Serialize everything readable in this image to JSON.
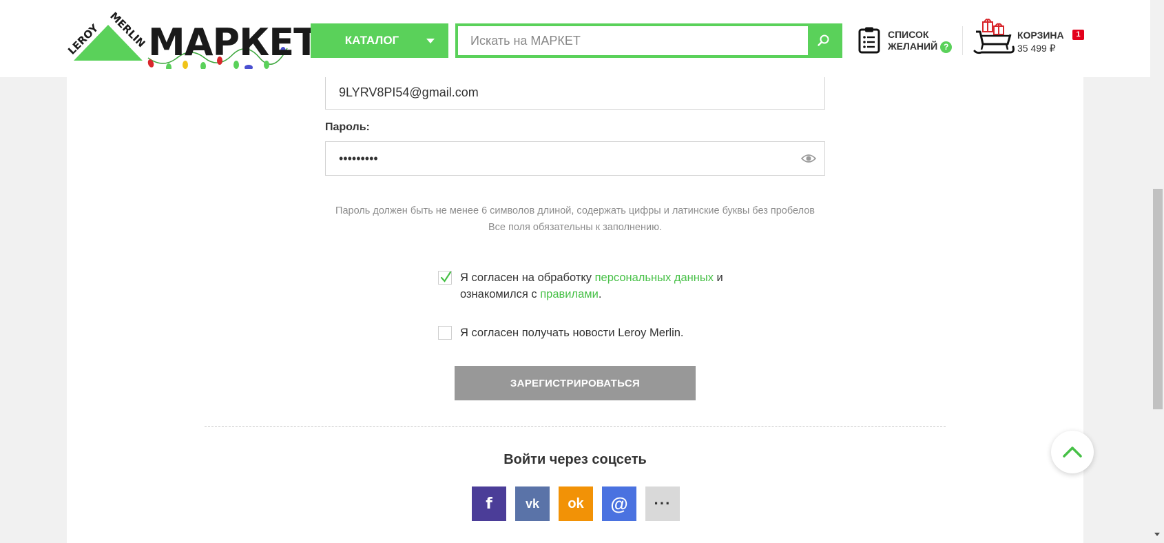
{
  "header": {
    "logo_brand": "LEROY MERLIN",
    "logo_word": "МАРКЕТ",
    "catalog_label": "КАТАЛОГ",
    "search_placeholder": "Искать на МАРКЕТ",
    "wishlist_line1": "СПИСОК",
    "wishlist_line2": "ЖЕЛАНИЙ",
    "wishlist_help": "?",
    "cart_title": "КОРЗИНА",
    "cart_total": "35 499 ₽",
    "cart_count": "1"
  },
  "form": {
    "email_value": "9LYRV8PI54@gmail.com",
    "password_label": "Пароль:",
    "password_value": "•••••••••",
    "hint_password": "Пароль должен быть не менее 6 символов длиной, содержать цифры и латинские буквы без пробелов",
    "hint_required": "Все поля обязательны к заполнению.",
    "consent_text_1": "Я согласен на обработку ",
    "consent_link_personal": "персональных данных",
    "consent_text_2": " и",
    "consent_text_3": "ознакомился с ",
    "consent_link_rules": "правилами",
    "consent_text_4": ".",
    "consent_checked": true,
    "news_text": "Я согласен получать новости Leroy Merlin.",
    "news_checked": false,
    "register_label": "ЗАРЕГИСТРИРОВАТЬСЯ"
  },
  "social": {
    "title": "Войти через соцсеть",
    "buttons": [
      {
        "name": "facebook",
        "glyph": "f"
      },
      {
        "name": "vkontakte",
        "glyph": "vk"
      },
      {
        "name": "odnoklassniki",
        "glyph": "ok"
      },
      {
        "name": "mail-ru",
        "glyph": "@"
      },
      {
        "name": "more",
        "glyph": "···"
      }
    ]
  },
  "colors": {
    "accent_green": "#5ad15a",
    "link_green": "#46c046",
    "button_disabled": "#989898",
    "cart_badge": "#e3001b",
    "facebook": "#4b3d98",
    "vk": "#5a73a8",
    "ok": "#f29206",
    "mail": "#4a72e0"
  },
  "icons": [
    "search-icon",
    "clipboard-list-icon",
    "help-icon",
    "sleigh-cart-icon",
    "eye-icon",
    "checkmark-icon",
    "chevron-up-icon"
  ]
}
